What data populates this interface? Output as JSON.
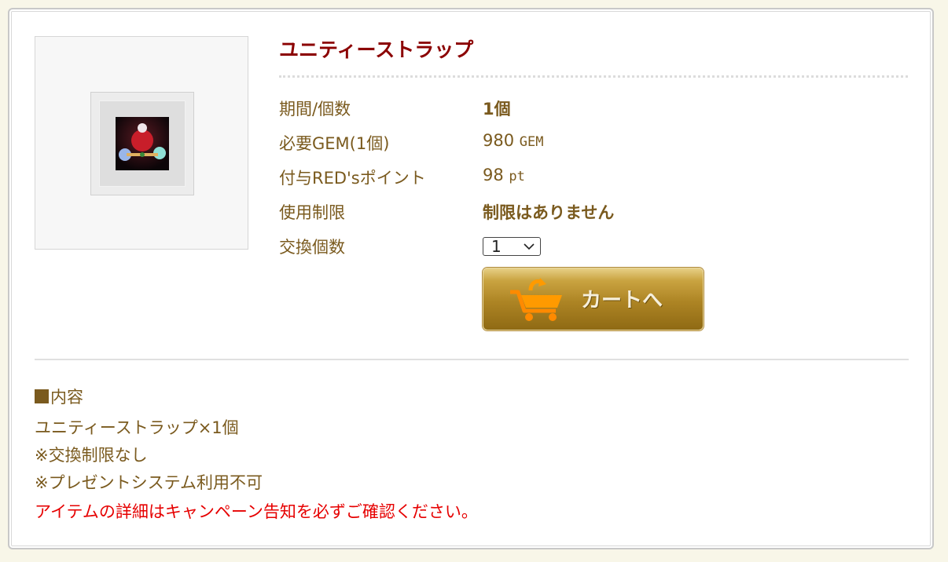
{
  "product": {
    "title": "ユニティーストラップ",
    "image_icon": "unity-strap-item-icon"
  },
  "details": {
    "period_label": "期間/個数",
    "period_value": "1個",
    "gem_label": "必要GEM(1個)",
    "gem_value": "980",
    "gem_unit": "GEM",
    "points_label": "付与RED'sポイント",
    "points_value": "98",
    "points_unit": "pt",
    "limit_label": "使用制限",
    "limit_value": "制限はありません",
    "quantity_label": "交換個数",
    "quantity_selected": "1"
  },
  "cart_button": {
    "label": "カートへ",
    "icon": "shopping-cart-icon"
  },
  "description": {
    "heading": "内容",
    "line1": "ユニティーストラップ×1個",
    "line2": "※交換制限なし",
    "line3": "※プレゼントシステム利用不可",
    "notice": "アイテムの詳細はキャンペーン告知を必ずご確認ください。"
  },
  "colors": {
    "title": "#8b0000",
    "text": "#7a5a1e",
    "notice": "#e60000",
    "button_gold": "#ad8424",
    "background": "#f8f6e8"
  }
}
